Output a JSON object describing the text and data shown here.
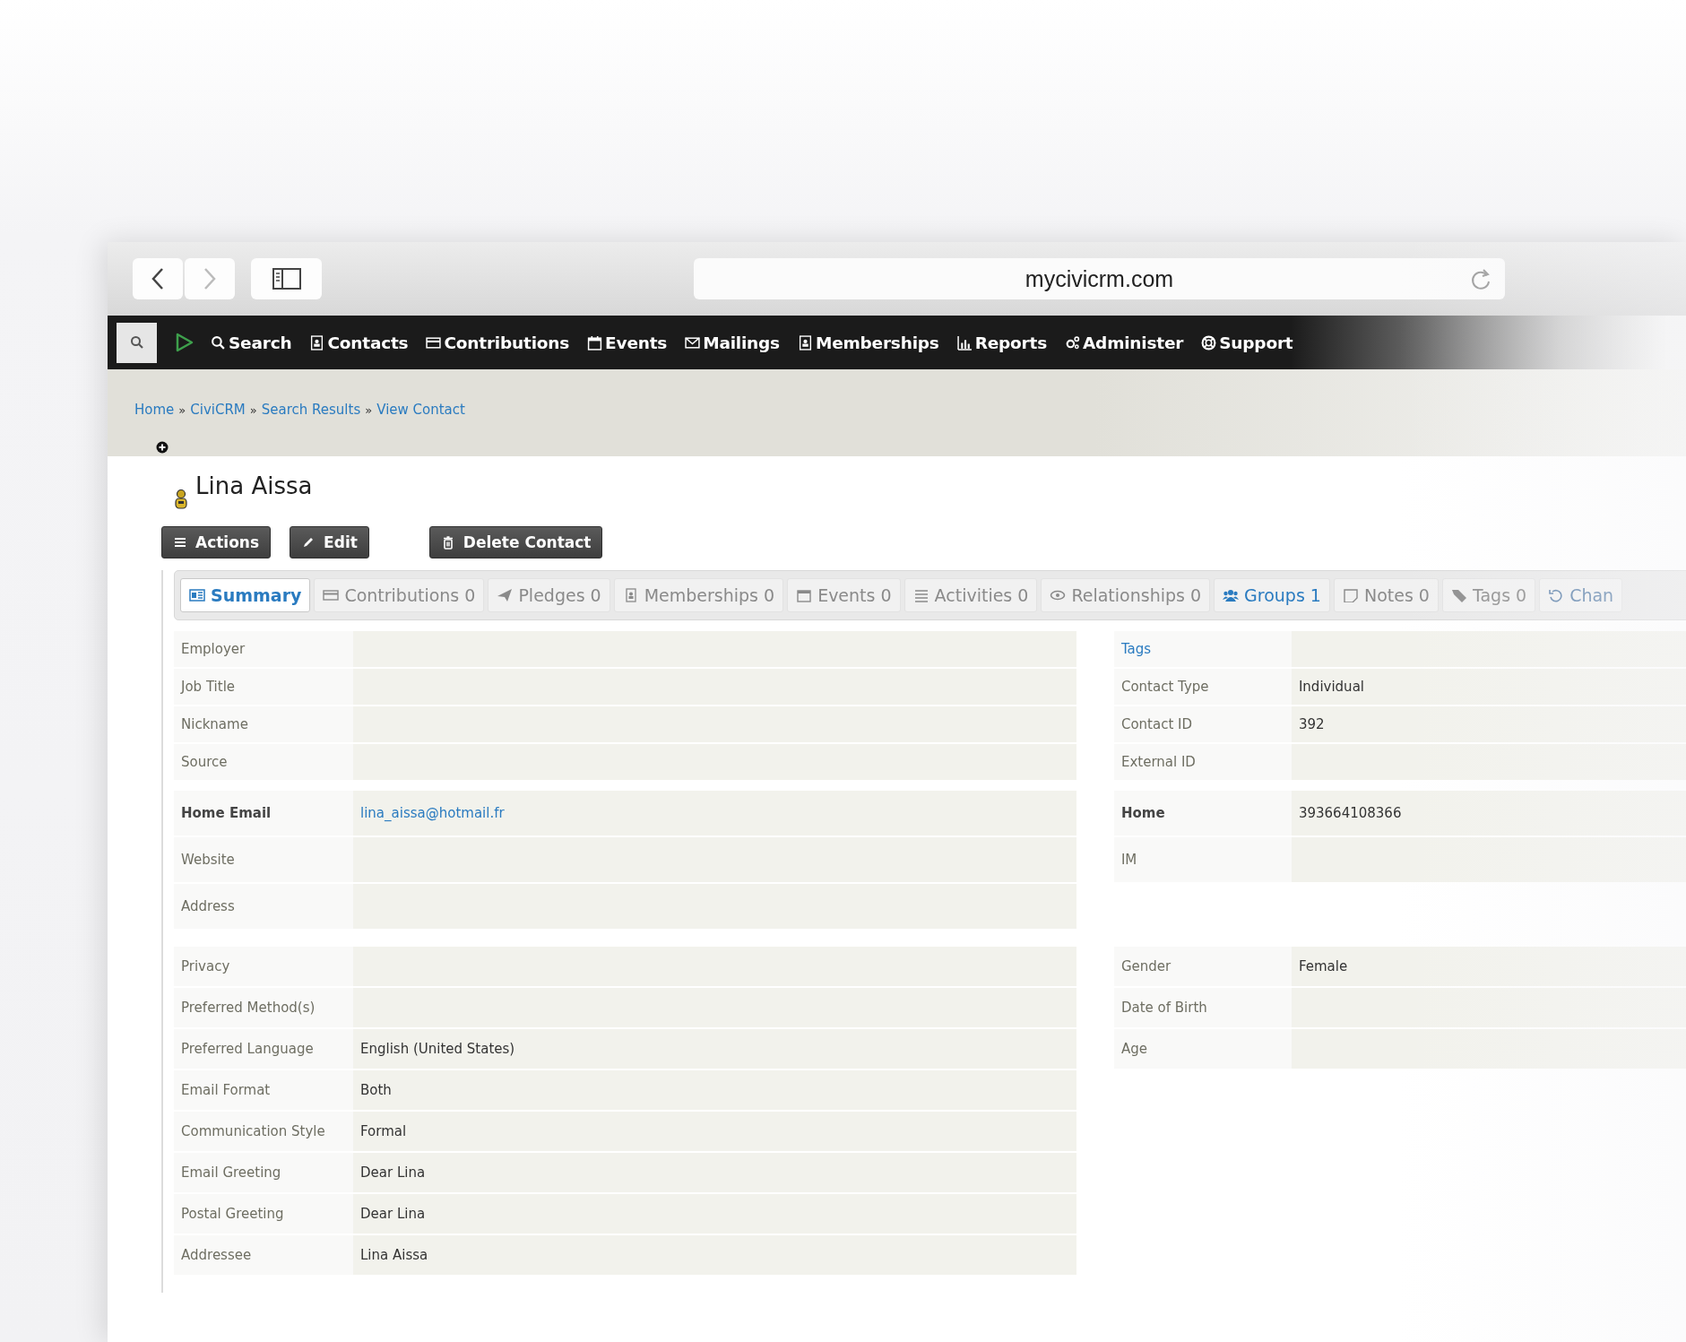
{
  "browser": {
    "url": "mycivicrm.com"
  },
  "nav": {
    "items": [
      "Search",
      "Contacts",
      "Contributions",
      "Events",
      "Mailings",
      "Memberships",
      "Reports",
      "Administer",
      "Support"
    ]
  },
  "breadcrumb": {
    "separator": "»",
    "items": [
      "Home",
      "CiviCRM",
      "Search Results",
      "View Contact"
    ]
  },
  "contact": {
    "name": "Lina Aissa"
  },
  "buttons": [
    "Actions",
    "Edit",
    "Delete Contact"
  ],
  "tabs": [
    {
      "label": "Summary",
      "selected": true,
      "hover": false
    },
    {
      "label": "Contributions 0",
      "selected": false,
      "hover": false
    },
    {
      "label": "Pledges 0",
      "selected": false,
      "hover": false
    },
    {
      "label": "Memberships 0",
      "selected": false,
      "hover": false
    },
    {
      "label": "Events 0",
      "selected": false,
      "hover": false
    },
    {
      "label": "Activities 0",
      "selected": false,
      "hover": false
    },
    {
      "label": "Relationships 0",
      "selected": false,
      "hover": false
    },
    {
      "label": "Groups 1",
      "selected": false,
      "hover": true
    },
    {
      "label": "Notes 0",
      "selected": false,
      "hover": false
    },
    {
      "label": "Tags 0",
      "selected": false,
      "hover": false
    },
    {
      "label": "Chan",
      "selected": false,
      "hover": false
    }
  ],
  "sections": [
    {
      "left": [
        {
          "label": "Employer",
          "kind": "plain"
        },
        {
          "label": "Job Title",
          "kind": "plain"
        },
        {
          "label": "Nickname",
          "kind": "plain"
        },
        {
          "label": "Source",
          "kind": "plain"
        }
      ],
      "right": [
        {
          "label": "Tags",
          "kind": "link-label"
        },
        {
          "label": "Contact Type",
          "value": "Individual",
          "kind": "plain"
        },
        {
          "label": "Contact ID",
          "value": "392",
          "kind": "plain"
        },
        {
          "label": "External ID",
          "kind": "plain"
        }
      ]
    },
    {
      "left": [
        {
          "label": "Home Email",
          "value": "lina_aissa@hotmail.fr",
          "kind": "email"
        },
        {
          "label": "Website",
          "kind": "plain"
        },
        {
          "label": "Address",
          "kind": "plain"
        }
      ],
      "right": [
        {
          "label": "Home",
          "value": "393664108366",
          "kind": "primary"
        },
        {
          "label": "IM",
          "kind": "plain"
        }
      ]
    },
    {
      "left": [
        {
          "label": "Privacy",
          "kind": "plain"
        },
        {
          "label": "Preferred Method(s)",
          "kind": "plain"
        },
        {
          "label": "Preferred Language",
          "value": "English (United States)",
          "kind": "plain"
        },
        {
          "label": "Email Format",
          "value": "Both",
          "kind": "plain"
        },
        {
          "label": "Communication Style",
          "value": "Formal",
          "kind": "plain"
        },
        {
          "label": "Email Greeting",
          "value": "Dear Lina",
          "kind": "plain"
        },
        {
          "label": "Postal Greeting",
          "value": "Dear Lina",
          "kind": "plain"
        },
        {
          "label": "Addressee",
          "value": "Lina Aissa",
          "kind": "plain"
        }
      ],
      "right": [
        {
          "label": "Gender",
          "value": "Female",
          "kind": "plain"
        },
        {
          "label": "Date of Birth",
          "kind": "plain"
        },
        {
          "label": "Age",
          "kind": "plain"
        }
      ]
    }
  ]
}
